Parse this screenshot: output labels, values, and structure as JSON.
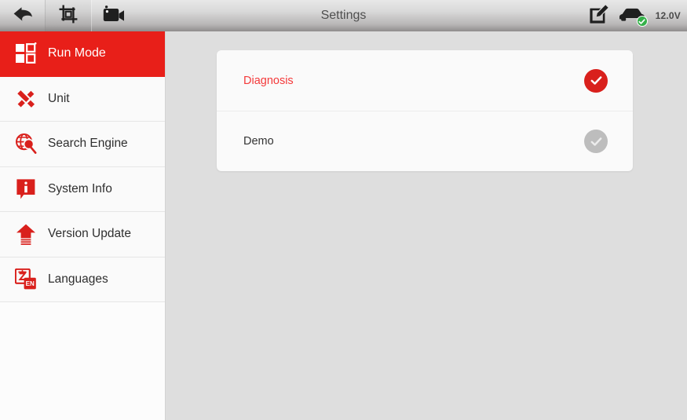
{
  "titlebar": {
    "title": "Settings",
    "back_icon": "back-arrow-icon",
    "screenshot_icon": "crop-screenshot-icon",
    "record_icon": "video-camera-icon",
    "edit_icon": "edit-note-icon",
    "vehicle_icon": "car-icon",
    "connection_badge_icon": "check-badge-icon",
    "voltage": "12.0V"
  },
  "sidebar": {
    "items": [
      {
        "label": "Run Mode",
        "icon": "grid-squares-icon",
        "active": true
      },
      {
        "label": "Unit",
        "icon": "ruler-pencil-icon",
        "active": false
      },
      {
        "label": "Search Engine",
        "icon": "globe-magnifier-icon",
        "active": false
      },
      {
        "label": "System Info",
        "icon": "info-bubble-icon",
        "active": false
      },
      {
        "label": "Version Update",
        "icon": "upload-arrow-icon",
        "active": false
      },
      {
        "label": "Languages",
        "icon": "translate-en-icon",
        "active": false
      }
    ]
  },
  "main": {
    "options": [
      {
        "label": "Diagnosis",
        "selected": true,
        "check_icon": "check-circle-filled-icon"
      },
      {
        "label": "Demo",
        "selected": false,
        "check_icon": "check-circle-muted-icon"
      }
    ]
  },
  "colors": {
    "brand_red": "#e81f19",
    "selected_text_red": "#f4393a",
    "check_on": "#d9201c",
    "check_off": "#bdbdbd",
    "content_bg": "#dedede",
    "card_bg": "#fafafa",
    "badge_green": "#35b14a"
  }
}
